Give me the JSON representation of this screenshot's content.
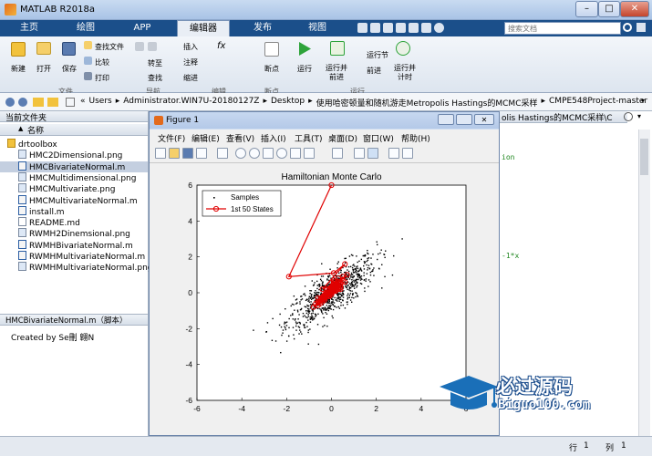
{
  "window": {
    "title": "MATLAB R2018a",
    "min": "–",
    "max": "□",
    "close": "✕"
  },
  "tabs": [
    "主页",
    "绘图",
    "APP",
    "编辑器",
    "发布",
    "视图"
  ],
  "search": {
    "placeholder": "搜索文档"
  },
  "ribbon": {
    "file": {
      "new": "新建",
      "open": "打开",
      "save": "保存",
      "find_files": "查找文件",
      "compare": "比较",
      "print": "打印",
      "group": "文件"
    },
    "navigate": {
      "goto": "转至",
      "find": "查找",
      "group": "导航"
    },
    "edit": {
      "insert": "插入",
      "comment": "注释",
      "indent": "缩进",
      "fx": "fx",
      "group": "编辑"
    },
    "breakpoints": {
      "label": "断点",
      "group": "断点"
    },
    "run": {
      "run": "运行",
      "run_advance": "运行并前进",
      "run_section": "运行节",
      "advance": "前进",
      "run_time": "运行并计时",
      "group": "运行"
    }
  },
  "address": {
    "segments": [
      "«",
      "Users",
      "▸",
      "Administrator.WIN7U-20180127Z",
      "▸",
      "Desktop",
      "▸",
      "使用哈密顿量和随机游走Metropolis Hastings的MCMC采样",
      "▸",
      "CMPE548Project-master"
    ]
  },
  "file_panel": {
    "title": "当前文件夹",
    "column": "名称",
    "sort": "▲",
    "items": [
      {
        "name": "drtoolbox",
        "type": "folder",
        "selected": false
      },
      {
        "name": "HMC2Dimensional.png",
        "type": "png",
        "selected": false
      },
      {
        "name": "HMCBivariateNormal.m",
        "type": "m",
        "selected": true
      },
      {
        "name": "HMCMultidimensional.png",
        "type": "png",
        "selected": false
      },
      {
        "name": "HMCMultivariate.png",
        "type": "png",
        "selected": false
      },
      {
        "name": "HMCMultivariateNormal.m",
        "type": "m",
        "selected": false
      },
      {
        "name": "install.m",
        "type": "m",
        "selected": false
      },
      {
        "name": "README.md",
        "type": "md",
        "selected": false
      },
      {
        "name": "RWMH2Dinemsional.png",
        "type": "png",
        "selected": false
      },
      {
        "name": "RWMHBivariateNormal.m",
        "type": "m",
        "selected": false
      },
      {
        "name": "RWMHMultivariateNormal.m",
        "type": "m",
        "selected": false
      },
      {
        "name": "RWMHMultivariateNormal.png",
        "type": "png",
        "selected": false
      }
    ]
  },
  "details": {
    "title": "HMCBivariateNormal.m（脚本）",
    "created_by": "Created by Se刪 翺N"
  },
  "editor": {
    "tab_text": "olis Hastings的MCMC采样\\C",
    "line1": "ion",
    "line2": "-1*x"
  },
  "status": {
    "row_label": "行",
    "row": "1",
    "col_label": "列",
    "col": "1"
  },
  "figure": {
    "title": "Figure 1",
    "menus": [
      "文件(F)",
      "编辑(E)",
      "查看(V)",
      "插入(I)",
      "工具(T)",
      "桌面(D)",
      "窗口(W)",
      "帮助(H)"
    ]
  },
  "logo": {
    "cn": "必过源码",
    "en": "Biguo100.com"
  },
  "colors": {
    "accent": "#1b4f8a",
    "path": "#e00000",
    "samples": "#000000"
  },
  "chart_data": {
    "type": "scatter",
    "title": "Hamiltonian Monte Carlo",
    "xlim": [
      -6,
      6
    ],
    "ylim": [
      -6,
      6
    ],
    "xticks": [
      -6,
      -4,
      -2,
      0,
      2,
      4,
      6
    ],
    "yticks": [
      -6,
      -4,
      -2,
      0,
      2,
      4,
      6
    ],
    "legend": {
      "placement": "top-left",
      "entries": [
        "Samples",
        "1st 50 States"
      ]
    },
    "series": [
      {
        "name": "Samples",
        "marker": "dot",
        "count": 800,
        "mean": [
          0,
          0
        ],
        "cov": [
          [
            1,
            0.8
          ],
          [
            0.8,
            1
          ]
        ]
      },
      {
        "name": "1st 50 States",
        "marker": "circle-line",
        "x": [
          0.0,
          -1.9,
          0.1,
          0.6,
          -0.4,
          0.3,
          -0.6,
          0.5,
          -0.1,
          0.4,
          -0.7,
          0.2,
          -0.3,
          0.7,
          -0.2,
          0.1,
          -0.8,
          0.4,
          -0.5,
          0.2,
          0.0,
          -0.6,
          0.3,
          -0.4,
          0.6,
          -0.1,
          0.2,
          -0.3,
          0.4,
          -0.2,
          0.1,
          -0.5,
          0.3,
          0.0,
          -0.4,
          0.2,
          -0.1,
          0.5,
          -0.3,
          0.1,
          -0.6,
          0.4,
          -0.2,
          0.3,
          0.0,
          -0.3,
          0.2,
          -0.1,
          0.1,
          0.0
        ],
        "y": [
          6.0,
          0.9,
          1.1,
          1.6,
          0.2,
          0.6,
          -0.5,
          0.9,
          -0.2,
          0.4,
          -0.6,
          0.5,
          -0.1,
          1.0,
          0.2,
          0.7,
          -0.8,
          0.3,
          -0.4,
          0.5,
          0.1,
          -0.3,
          0.8,
          -0.5,
          0.6,
          0.0,
          0.4,
          -0.2,
          0.3,
          -0.1,
          0.6,
          -0.6,
          0.2,
          0.3,
          -0.4,
          0.1,
          -0.2,
          0.7,
          -0.3,
          0.5,
          -0.7,
          0.2,
          0.0,
          0.4,
          -0.1,
          -0.4,
          0.3,
          0.1,
          0.2,
          0.0
        ]
      }
    ]
  }
}
